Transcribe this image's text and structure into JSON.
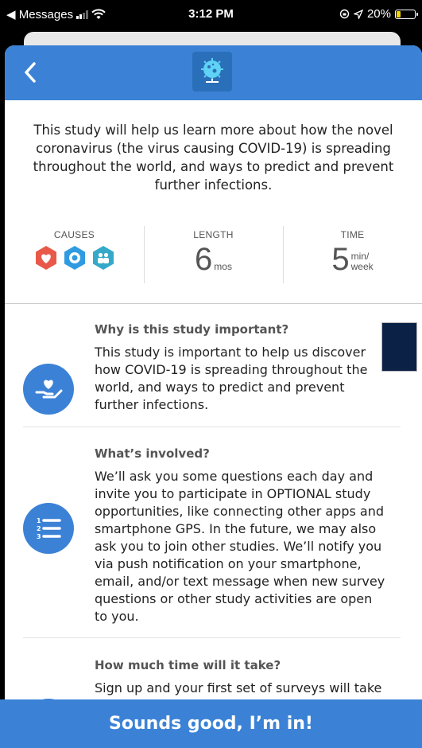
{
  "status_bar": {
    "back_app": "◀ Messages",
    "time": "3:12 PM",
    "battery": "20%"
  },
  "header": {
    "back_icon": "chevron-left-icon",
    "logo_icon": "globe-virus-icon"
  },
  "intro": "This study will help us learn more about how the novel coronavirus (the virus causing COVID-19) is spreading throughout the world, and ways to predict and prevent further infections.",
  "stats": {
    "causes_label": "CAUSES",
    "causes_icons": [
      "heart-icon",
      "target-icon",
      "people-icon"
    ],
    "length_label": "LENGTH",
    "length_value": "6",
    "length_unit": "mos",
    "time_label": "TIME",
    "time_value": "5",
    "time_unit_top": "min/",
    "time_unit_bottom": "week"
  },
  "sections": [
    {
      "title": "Why is this study important?",
      "body": "This study is important to help us discover how COVID-19 is spreading throughout the world, and ways to predict and prevent further infections.",
      "icon": "heart-hand-icon"
    },
    {
      "title": "What’s involved?",
      "body": "We’ll ask you some questions each day and invite you to participate in OPTIONAL study opportunities, like connecting other apps and smartphone GPS. In the future, we may also ask you to join other studies. We’ll notify you via push notification on your smartphone, email, and/or text message when new survey questions or other study activities are open to you.",
      "icon": "numbered-list-icon"
    },
    {
      "title": "How much time will it take?",
      "body": "Sign up and your first set of surveys will take",
      "icon": "calendar-icon"
    }
  ],
  "cta_label": "Sounds good, I’m in!",
  "colors": {
    "brand_blue": "#3b82d6",
    "cause_red": "#e8594a",
    "cause_blue": "#2f9be0",
    "cause_teal": "#36a9c9"
  }
}
